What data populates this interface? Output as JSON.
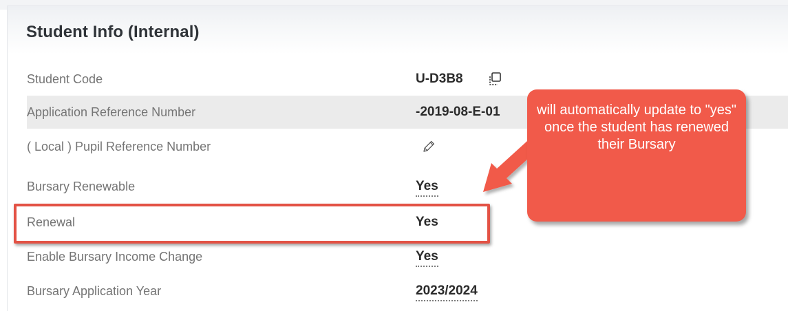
{
  "panel": {
    "title": "Student Info (Internal)"
  },
  "rows": [
    {
      "label": "Student Code",
      "value": "U-D3B8"
    },
    {
      "label": "Application Reference Number",
      "value": "-2019-08-E-01"
    },
    {
      "label": "( Local ) Pupil Reference Number",
      "value": ""
    },
    {
      "label": "Bursary Renewable",
      "value": "Yes"
    },
    {
      "label": "Renewal",
      "value": "Yes"
    },
    {
      "label": "Enable Bursary Income Change",
      "value": "Yes"
    },
    {
      "label": "Bursary Application Year",
      "value": "2023/2024"
    }
  ],
  "icons": {
    "copy": "copy-icon",
    "edit": "pencil-icon"
  },
  "annotation": {
    "text": "will automatically update to \"yes\" once the student has renewed their Bursary",
    "color": "#f15a4a",
    "highlight_color": "#e35245"
  }
}
